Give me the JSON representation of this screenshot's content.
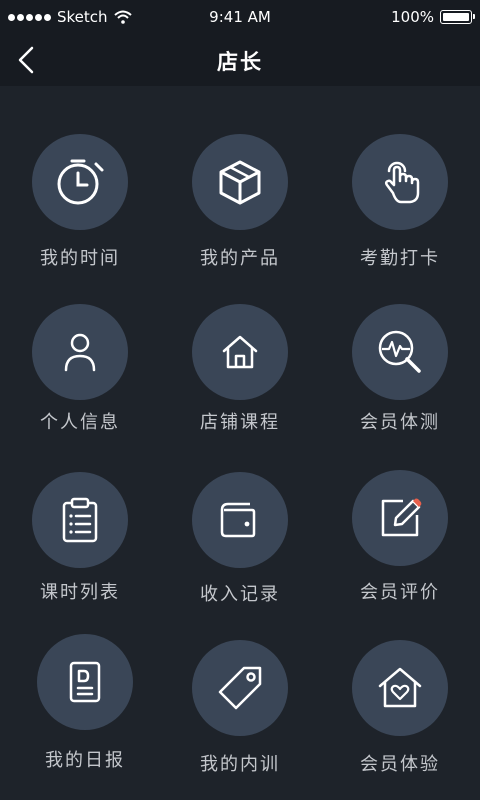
{
  "status": {
    "carrier": "Sketch",
    "time": "9:41 AM",
    "battery": "100%"
  },
  "nav": {
    "title": "店长"
  },
  "menu": [
    {
      "label": "我的时间",
      "icon": "stopwatch-icon"
    },
    {
      "label": "我的产品",
      "icon": "box-icon"
    },
    {
      "label": "考勤打卡",
      "icon": "tap-hand-icon"
    },
    {
      "label": "个人信息",
      "icon": "person-icon"
    },
    {
      "label": "店铺课程",
      "icon": "home-icon"
    },
    {
      "label": "会员体测",
      "icon": "health-search-icon"
    },
    {
      "label": "课时列表",
      "icon": "clipboard-list-icon"
    },
    {
      "label": "收入记录",
      "icon": "wallet-icon"
    },
    {
      "label": "会员评价",
      "icon": "edit-note-icon"
    },
    {
      "label": "我的日报",
      "icon": "daily-report-icon"
    },
    {
      "label": "我的内训",
      "icon": "tag-icon"
    },
    {
      "label": "会员体验",
      "icon": "heart-home-icon"
    }
  ],
  "colors": {
    "background": "#1e232a",
    "bar": "#171b21",
    "circle": "#3a4657",
    "accent": "#e8604c"
  }
}
